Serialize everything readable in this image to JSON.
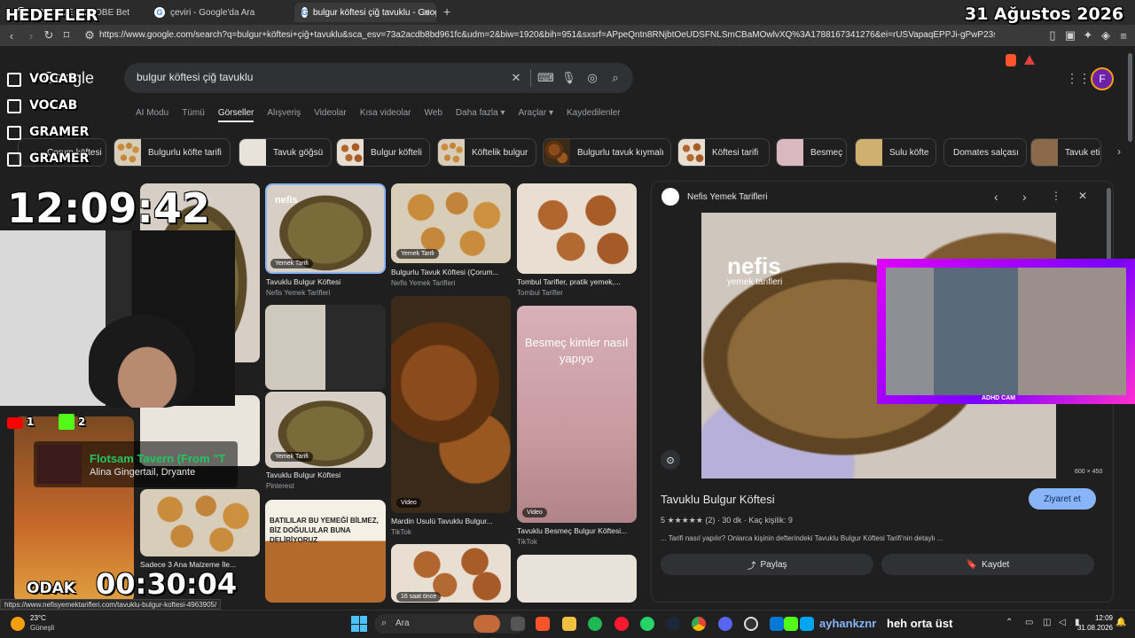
{
  "browser": {
    "tabs": [
      {
        "title": "PREFACE – GLOBE Bet",
        "active": false
      },
      {
        "title": "çeviri - Google'da Ara",
        "active": false
      },
      {
        "title": "bulgur köftesi çiğ tavuklu - Goog",
        "active": true
      }
    ],
    "url": "https://www.google.com/search?q=bulgur+köftesi+çiğ+tavuklu&sca_esv=73a2acdb8bd961fc&udm=2&biw=1920&bih=951&sxsrf=APpeQntn8RNjbtOeUDSFNLSmCBaMOwlvXQ%3A1788167341276&ei=rUSVapaqEPPJi-gPwP23sQY&ved=0ah..."
  },
  "google": {
    "logo": "Google",
    "query": "bulgur köftesi çiğ tavuklu",
    "avatar_letter": "F",
    "nav_tabs": [
      "AI Modu",
      "Tümü",
      "Görseller",
      "Alışveriş",
      "Videolar",
      "Kısa videolar",
      "Web",
      "Daha fazla ▾",
      "Araçlar ▾",
      "Kaydedilenler"
    ],
    "active_tab": "Görseller",
    "chips": [
      "Çorum köftesi",
      "Bulgurlu köfte tarifi",
      "Tavuk göğsü",
      "Bulgur köfteli",
      "Köftelik bulgur",
      "Bulgurlu tavuk kıymalı",
      "Köftesi tarifi",
      "Besmeç",
      "Sulu köfte",
      "Domates salçası",
      "Tavuk eti"
    ]
  },
  "results": [
    {
      "caption": "Tavuklu Bulgur Köftesi",
      "source": "Nefis Yemek Tarifleri",
      "badge": "Yemek Tarifi"
    },
    {
      "caption": "Bulgurlu Tavuk Köftesi (Çorum...",
      "source": "Nefis Yemek Tarifleri",
      "badge": "Yemek Tarifi"
    },
    {
      "caption": "Tombul Tarifler, pratik yemek,...",
      "source": "Tombul Tarifler"
    },
    {
      "caption": "Tavuklu Bulgur Köftesi",
      "source": "Pinterest",
      "badge": "Yemek Tarifi"
    },
    {
      "caption": "Mardin Usulü Tavuklu Bulgur...",
      "source": "TikTok",
      "badge": "Video"
    },
    {
      "caption": "Tavuklu Besmeç Bulgur Köftesi...",
      "source": "TikTok",
      "badge": "Video",
      "overlay": "Besmeç kimler nasıl yapıyo"
    },
    {
      "caption": "Sadece 3 Ana Malzeme İle...",
      "source": ""
    },
    {
      "overlay": "BATILILAR BU YEMEĞİ BİLMEZ, BİZ DOĞULULAR BUNA DELİRİYORUZ"
    },
    {
      "badge": "16 saat önce"
    }
  ],
  "panel": {
    "site": "Nefis Yemek Tarifleri",
    "title": "Tavuklu Bulgur Köftesi",
    "visit": "Ziyaret et",
    "rating_text": "5 ★★★★★ (2)  ·  30 dk  ·  Kaç kişilik: 9",
    "description": "... Tarifi nasıl yapılır? Onlarca kişinin defterindeki Tavuklu Bulgur Köftesi Tarifi'nin detaylı ...",
    "share": "Paylaş",
    "save": "Kaydet",
    "size": "600 × 450",
    "watermark_brand": "nefis",
    "watermark_sub": "yemek tarifleri"
  },
  "overlay": {
    "title": "HEDEFLER",
    "date": "31 Ağustos 2026",
    "checklist": [
      "VOCAB",
      "VOCAB",
      "GRAMER",
      "GRAMER"
    ],
    "clock": "12:09:42",
    "focus_label": "ODAK",
    "focus_timer": "00:30:04",
    "music_title": "Flotsam Tavern (From \"T",
    "music_artist": "Alina Gingertail, Dryante",
    "game_label": "ADHD CAM",
    "social_counts": [
      "1",
      "2"
    ]
  },
  "status_url": "https://www.nefisyemektarifleri.com/tavuklu-bulgur-koftesi-4963905/",
  "taskbar": {
    "weather_temp": "23°C",
    "weather_label": "Güneşli",
    "search": "Ara",
    "stream_user": "ayhankznr",
    "stream_msg": "heh orta üst",
    "time": "12:09",
    "date": "31.08.2026"
  }
}
